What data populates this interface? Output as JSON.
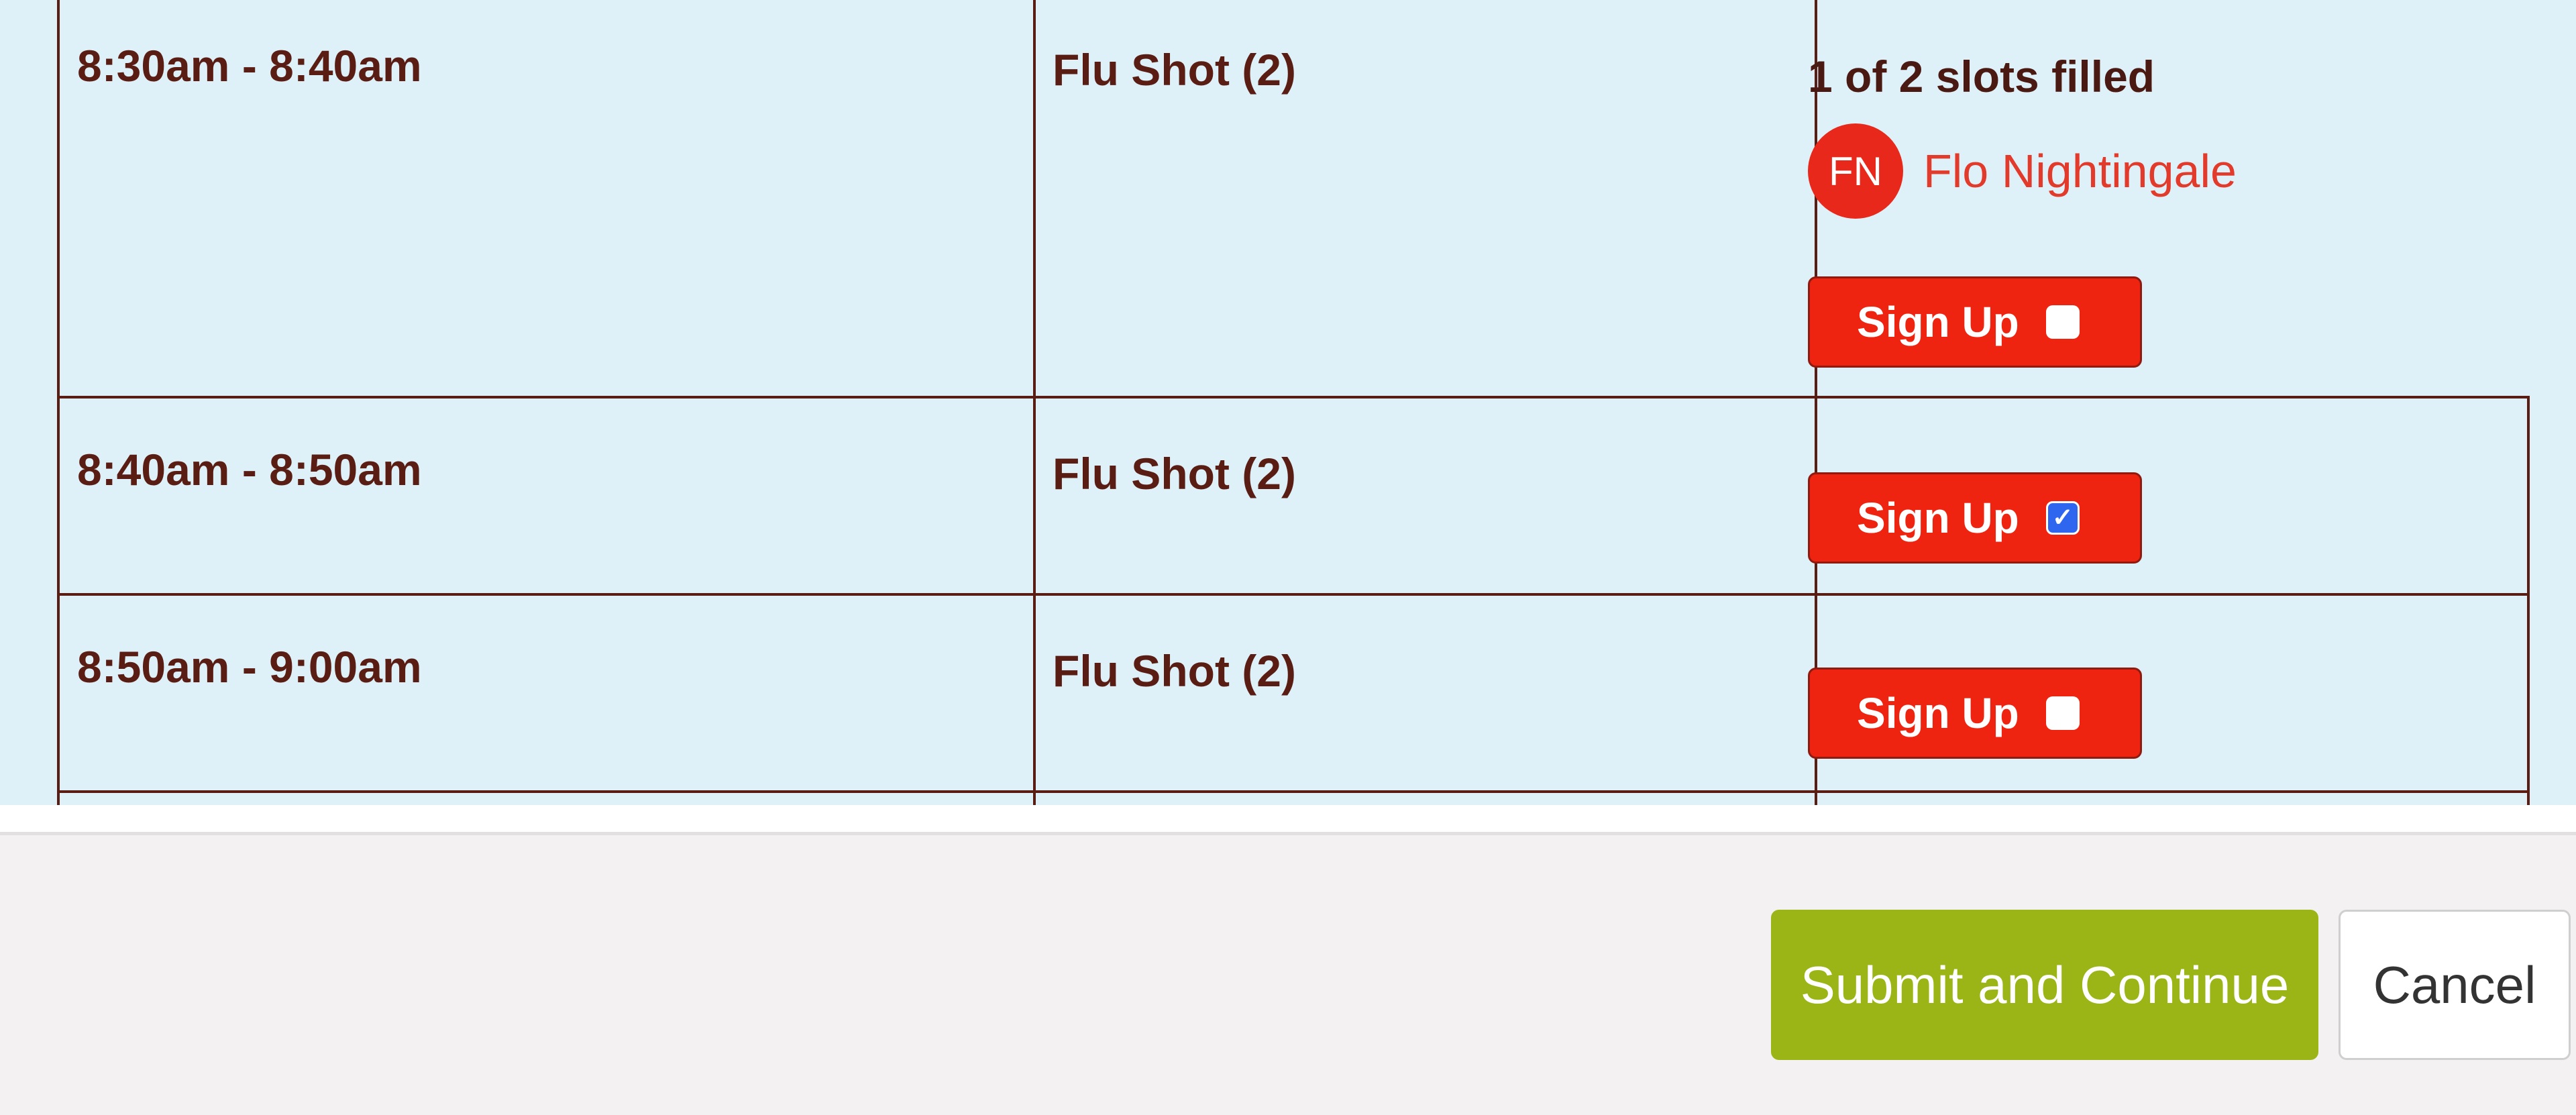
{
  "slots": [
    {
      "time": "8:30am - 8:40am",
      "item": "Flu Shot (2)",
      "filled_text": "1 of 2 slots filled",
      "volunteer": {
        "initials": "FN",
        "name": "Flo Nightingale"
      },
      "signup_label": "Sign Up",
      "checked": false
    },
    {
      "time": "8:40am - 8:50am",
      "item": "Flu Shot (2)",
      "signup_label": "Sign Up",
      "checked": true
    },
    {
      "time": "8:50am - 9:00am",
      "item": "Flu Shot (2)",
      "signup_label": "Sign Up",
      "checked": false
    }
  ],
  "footer": {
    "submit_label": "Submit and Continue",
    "cancel_label": "Cancel"
  },
  "colors": {
    "panel_bg": "#dff1f8",
    "border": "#5a1d14",
    "signup_button": "#ee2410",
    "submit_button": "#9cb516",
    "volunteer_name": "#e23a2b",
    "checkbox_checked": "#2e66f0"
  }
}
